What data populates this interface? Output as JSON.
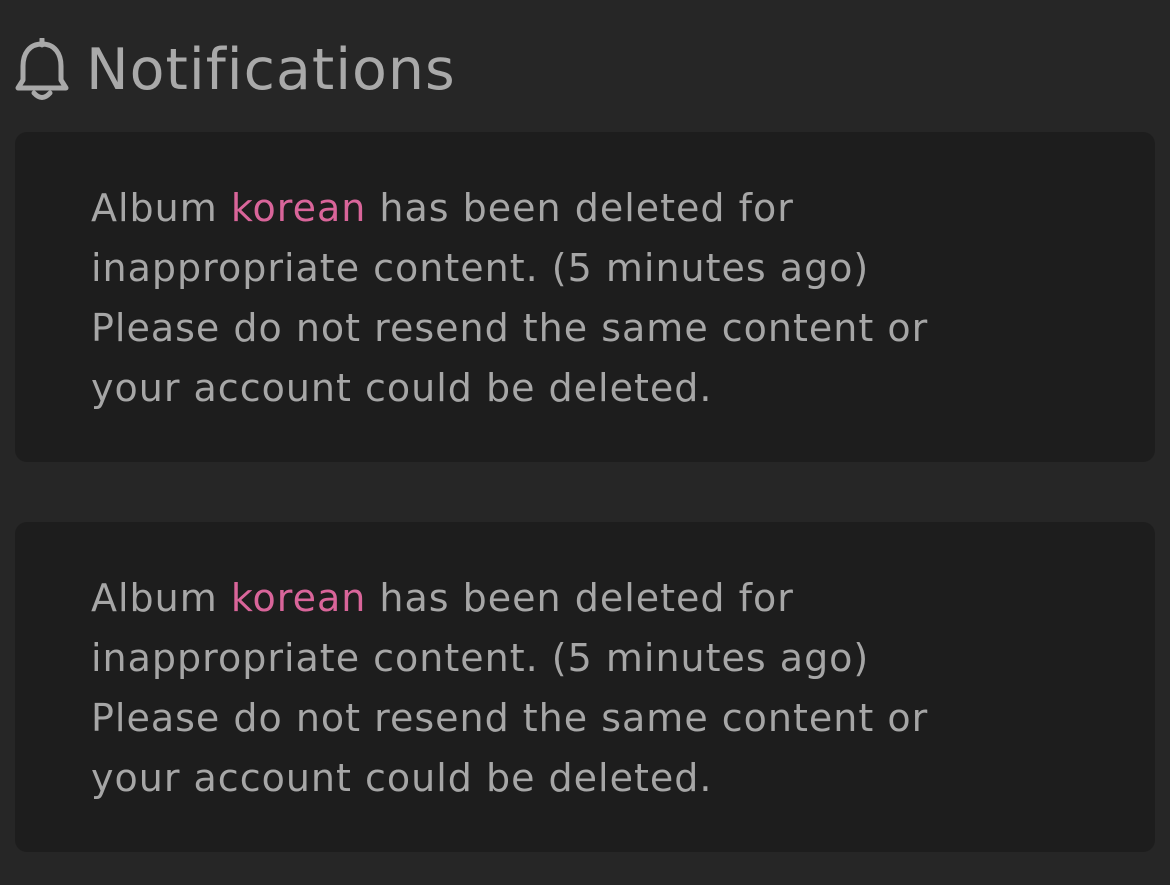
{
  "header": {
    "icon": "bell-icon",
    "title": "Notifications"
  },
  "colors": {
    "background": "#262626",
    "card": "#1d1d1d",
    "text": "#a6a6a6",
    "link": "#d9659a"
  },
  "notifications": [
    {
      "prefix": "Album",
      "album_name": "korean",
      "line1_rest": "has been deleted for",
      "line2": "inappropriate content. (5 minutes ago)",
      "line3": "Please do not resend the same content or",
      "line4": "your account could be deleted."
    },
    {
      "prefix": "Album",
      "album_name": "korean",
      "line1_rest": "has been deleted for",
      "line2": "inappropriate content. (5 minutes ago)",
      "line3": "Please do not resend the same content or",
      "line4": "your account could be deleted."
    }
  ]
}
